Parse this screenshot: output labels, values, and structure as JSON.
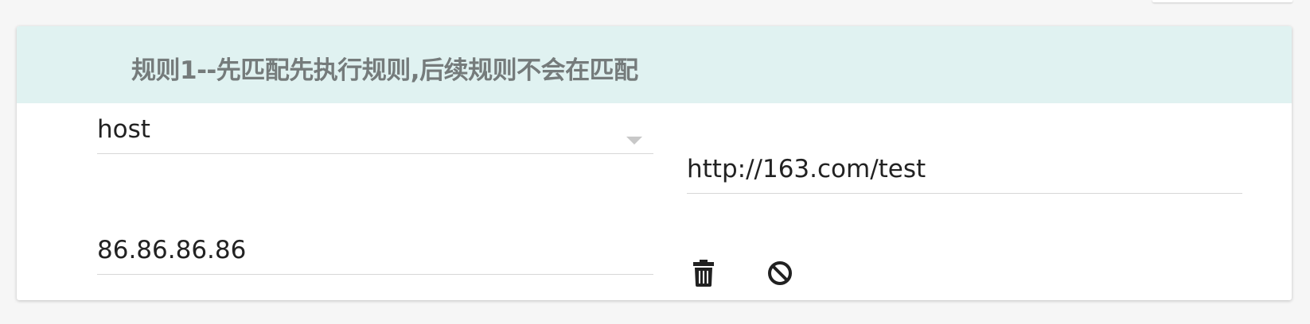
{
  "rule": {
    "title": "规则1--先匹配先执行规则,后续规则不会在匹配",
    "match_type": {
      "selected": "host"
    },
    "url": {
      "value": "http://163.com/test"
    },
    "target": {
      "value": "86.86.86.86"
    },
    "actions": {
      "delete_icon": "trash-icon",
      "disable_icon": "block-icon"
    }
  },
  "colors": {
    "header_bg": "#e0f2f1",
    "title_text": "#757b7b",
    "icon": "#212121"
  }
}
